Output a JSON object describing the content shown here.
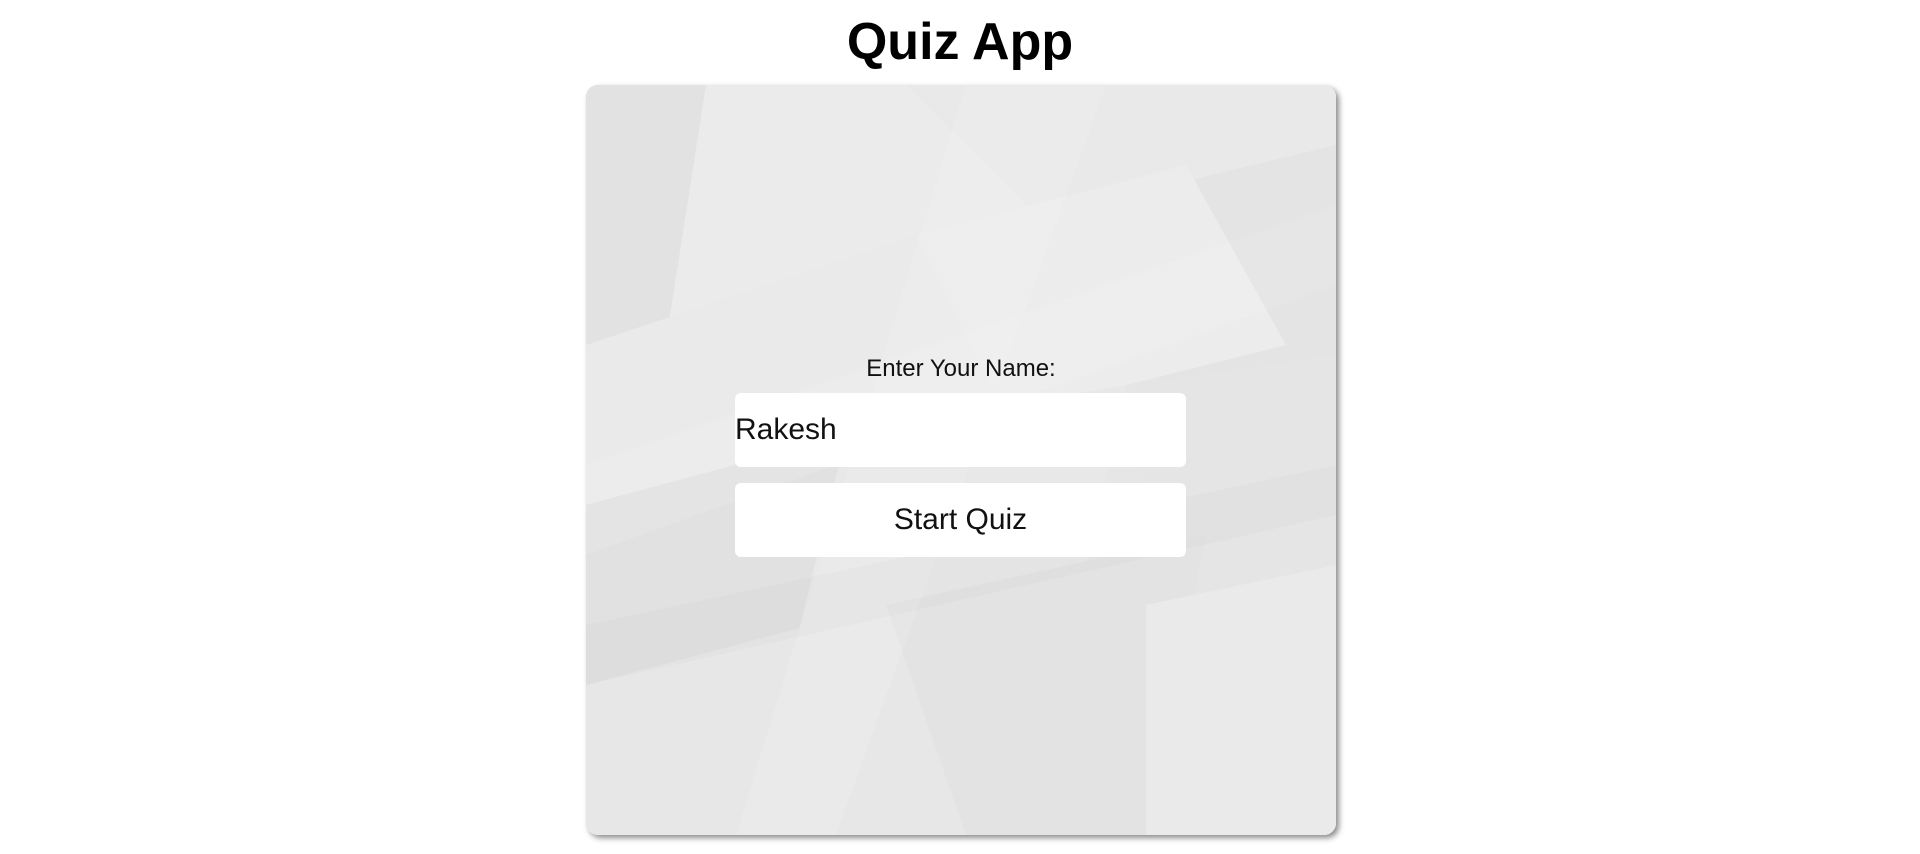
{
  "app": {
    "title": "Quiz App"
  },
  "form": {
    "name_label": "Enter Your Name:",
    "name_value": "Rakesh",
    "start_button_label": "Start Quiz"
  },
  "colors": {
    "card_background": "#e6e6e6",
    "field_background": "#ffffff",
    "title_text": "#000000"
  }
}
